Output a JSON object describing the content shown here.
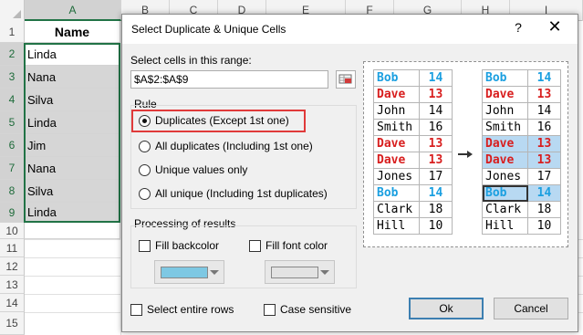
{
  "sheet": {
    "columns": [
      "A",
      "B",
      "C",
      "D",
      "E",
      "F",
      "G",
      "H",
      "I"
    ],
    "rows": [
      "1",
      "2",
      "3",
      "4",
      "5",
      "6",
      "7",
      "8",
      "9",
      "10",
      "11",
      "12",
      "13",
      "14",
      "15"
    ],
    "col_a": [
      "Name",
      "Linda",
      "Nana",
      "Silva",
      "Linda",
      "Jim",
      "Nana",
      "Silva",
      "Linda"
    ]
  },
  "dialog": {
    "title": "Select Duplicate & Unique Cells",
    "help": "?",
    "close": "✕",
    "range_label": "Select cells in this range:",
    "range_value": "$A$2:$A$9",
    "rule_label": "Rule",
    "rules": [
      "Duplicates (Except 1st one)",
      "All duplicates (Including 1st one)",
      "Unique values only",
      "All unique (Including 1st duplicates)"
    ],
    "selected_rule": 0,
    "processing_label": "Processing of results",
    "fill_backcolor": "Fill backcolor",
    "fill_font_color": "Fill font color",
    "backcolor_swatch": "#7ec8e3",
    "fontcolor_swatch": "#e3e3e3",
    "select_entire_rows": "Select entire rows",
    "case_sensitive": "Case sensitive",
    "ok": "Ok",
    "cancel": "Cancel"
  },
  "preview": {
    "before": [
      [
        "Bob",
        "14",
        "blue"
      ],
      [
        "Dave",
        "13",
        "red"
      ],
      [
        "John",
        "14",
        "blk"
      ],
      [
        "Smith",
        "16",
        "blk"
      ],
      [
        "Dave",
        "13",
        "red"
      ],
      [
        "Dave",
        "13",
        "red"
      ],
      [
        "Jones",
        "17",
        "blk"
      ],
      [
        "Bob",
        "14",
        "blue"
      ],
      [
        "Clark",
        "18",
        "blk"
      ],
      [
        "Hill",
        "10",
        "blk"
      ]
    ],
    "after": [
      [
        "Bob",
        "14",
        "blue"
      ],
      [
        "Dave",
        "13",
        "red"
      ],
      [
        "John",
        "14",
        "blk"
      ],
      [
        "Smith",
        "16",
        "blk"
      ],
      [
        "Dave",
        "13",
        "red"
      ],
      [
        "Dave",
        "13",
        "red"
      ],
      [
        "Jones",
        "17",
        "blk"
      ],
      [
        "Bob",
        "14",
        "blue"
      ],
      [
        "Clark",
        "18",
        "blk"
      ],
      [
        "Hill",
        "10",
        "blk"
      ]
    ],
    "after_highlight_rows": [
      4,
      5,
      7
    ]
  },
  "colors": {
    "excel_green": "#217346",
    "highlight_red": "#e03a3a",
    "preview_blue": "#1a9fe0",
    "preview_red": "#d81e1e",
    "preview_highlight": "#b8d9f2"
  }
}
